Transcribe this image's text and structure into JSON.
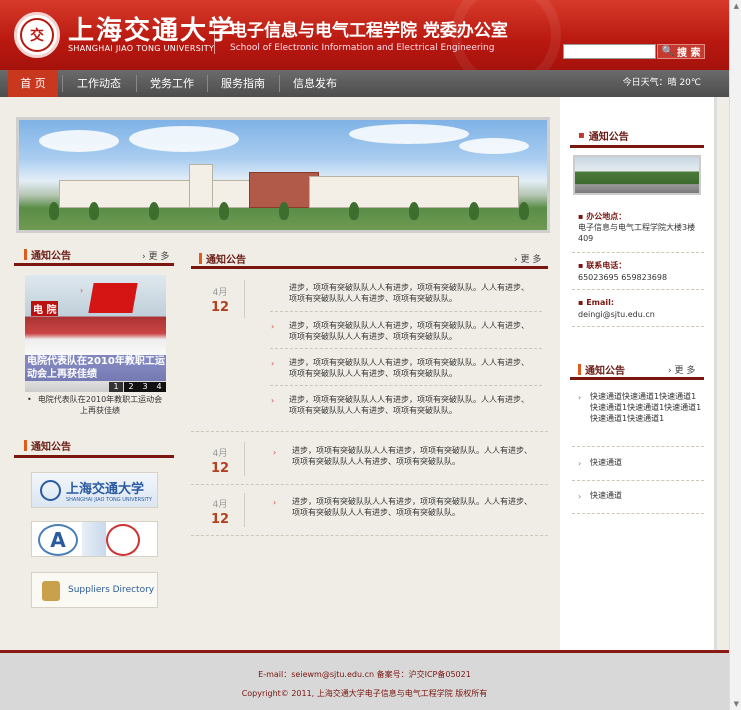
{
  "header": {
    "logo_cn": "上海交通大学",
    "logo_en": "SHANGHAI JIAO TONG UNIVERSITY",
    "school_cn": "电子信息与电气工程学院  党委办公室",
    "school_en": "School of Electronic Information and Electrical Engineering",
    "search_placeholder": "",
    "search_label": "搜 索"
  },
  "nav": {
    "items": [
      "首 页",
      "工作动态",
      "党务工作",
      "服务指南",
      "信息发布"
    ],
    "weather": "今日天气：晴  20℃"
  },
  "left": {
    "notice_title": "通知公告",
    "more": "更 多",
    "photo_sign": "电 院",
    "photo_overlay": "电院代表队在2010年教职工运动会上再获佳绩",
    "photo_pages": [
      "1",
      "2",
      "3",
      "4"
    ],
    "photo_caption": "电院代表队在2010年教职工运动会上再获佳绩",
    "links_title": "通知公告",
    "sjtu_logo_text": "上海交通大学",
    "sjtu_logo_sub": "SHANGHAI JIAO TONG UNIVERSITY",
    "supplier_text": "Suppliers Directory"
  },
  "center": {
    "title": "通知公告",
    "more": "更 多",
    "groups": [
      {
        "month": "4月",
        "day": "12",
        "items": [
          "进步，项项有突破队队人人有进步，项项有突破队队。人人有进步、项项有突破队队人人有进步、项项有突破队队。",
          "进步，项项有突破队队人人有进步，项项有突破队队。人人有进步、项项有突破队队人人有进步、项项有突破队队。",
          "进步，项项有突破队队人人有进步，项项有突破队队。人人有进步、项项有突破队队人人有进步、项项有突破队队。",
          "进步，项项有突破队队人人有进步，项项有突破队队。人人有进步、项项有突破队队人人有进步、项项有突破队队。"
        ]
      },
      {
        "month": "4月",
        "day": "12",
        "items": [
          "进步，项项有突破队队人人有进步，项项有突破队队。人人有进步、项项有突破队队人人有进步、项项有突破队队。"
        ]
      },
      {
        "month": "4月",
        "day": "12",
        "items": [
          "进步，项项有突破队队人人有进步，项项有突破队队。人人有进步、项项有突破队队人人有进步、项项有突破队队。"
        ]
      }
    ]
  },
  "right": {
    "notice_title": "通知公告",
    "office_label": "办公地点：",
    "office_value": "电子信息与电气工程学院大楼3楼409",
    "phone_label": "联系电话：",
    "phone_value": "65023695 659823698",
    "email_label": "Email:",
    "email_value": "deingi@sjtu.edu.cn",
    "links_title": "通知公告",
    "more": "更 多",
    "links": [
      "快速通道快速通道1快速通道1快速通道1快速通道1快速通道1快速通道1快速通道1",
      "快速通道",
      "快速通道"
    ]
  },
  "footer": {
    "line1": "E-mail：seiewm@sjtu.edu.cn 备案号：沪交ICP备05021",
    "line2": "Copyright© 2011, 上海交通大学电子信息与电气工程学院  版权所有"
  },
  "colors": {
    "brand_red": "#b8180f",
    "dark_maroon": "#7a1510",
    "accent_orange": "#e05a1c",
    "nav_gray": "#5a5a5a"
  }
}
